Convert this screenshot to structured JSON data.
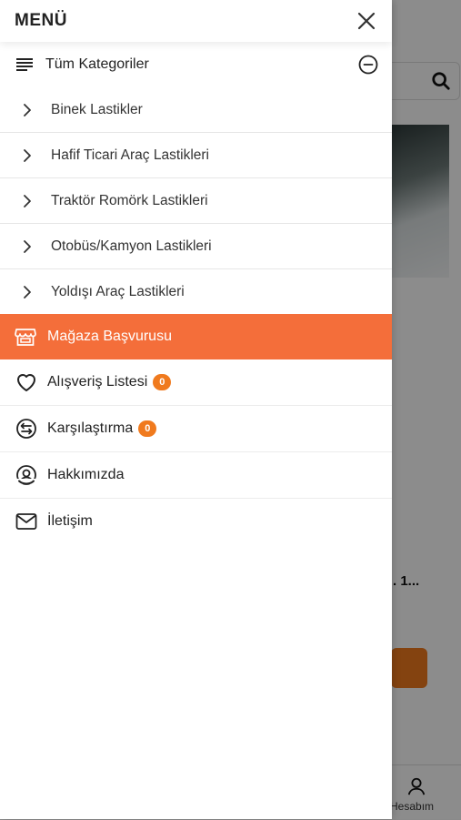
{
  "background": {
    "title_fragment": ". 1...",
    "nav_account_label": "Hesabım"
  },
  "drawer": {
    "title": "MENÜ",
    "all_categories_label": "Tüm Kategoriler",
    "categories": [
      {
        "label": "Binek Lastikler"
      },
      {
        "label": "Hafif Ticari Araç Lastikleri"
      },
      {
        "label": "Traktör Romörk Lastikleri"
      },
      {
        "label": "Otobüs/Kamyon Lastikleri"
      },
      {
        "label": "Yoldışı Araç Lastikleri"
      }
    ],
    "store_application_label": "Mağaza Başvurusu",
    "shopping_list": {
      "label": "Alışveriş Listesi",
      "count": "0"
    },
    "compare": {
      "label": "Karşılaştırma",
      "count": "0"
    },
    "about_label": "Hakkımızda",
    "contact_label": "İletişim"
  },
  "colors": {
    "accent": "#f46e3a",
    "badge": "#f07a1e"
  }
}
